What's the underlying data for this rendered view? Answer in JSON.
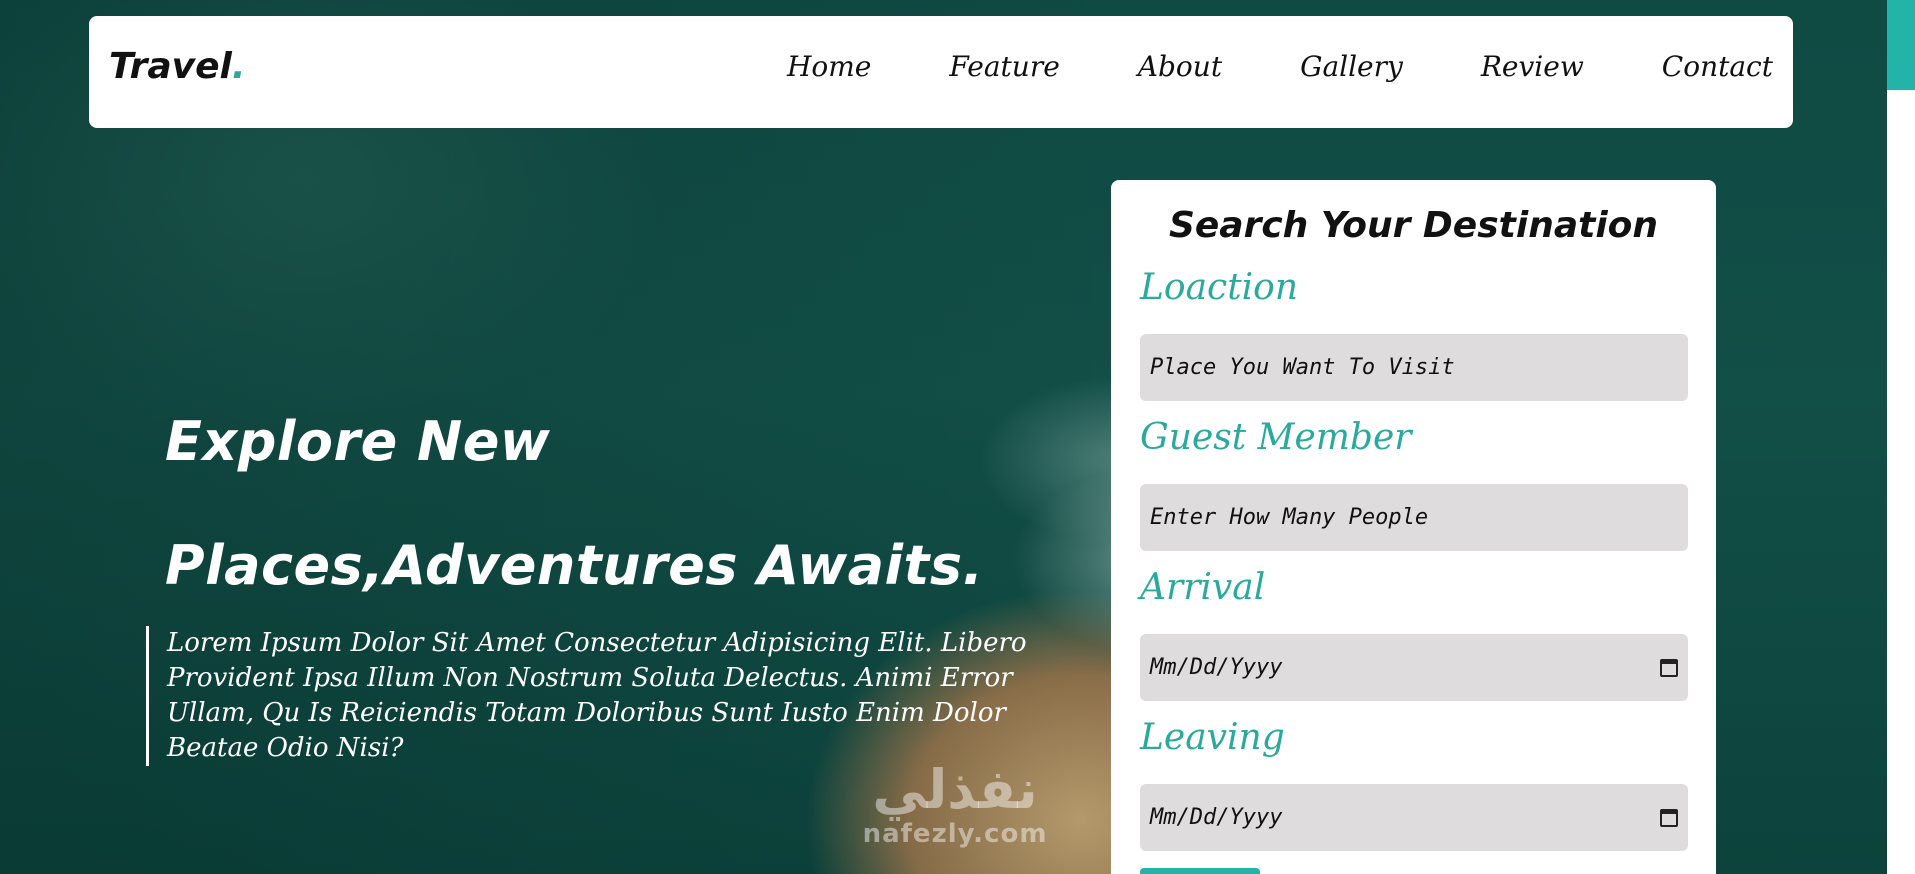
{
  "nav": {
    "logo_text": "Travel",
    "logo_dot": ".",
    "links": [
      "Home",
      "Feature",
      "About",
      "Gallery",
      "Review",
      "Contact"
    ]
  },
  "hero": {
    "title": "Explore New Places,Adventures Awaits.",
    "description": "Lorem Ipsum Dolor Sit Amet Consectetur Adipisicing Elit. Libero Provident Ipsa Illum Non Nostrum Soluta Delectus. Animi Error Ullam, Qu Is Reiciendis Totam Doloribus Sunt Iusto Enim Dolor Beatae Odio Nisi?"
  },
  "watermark": {
    "arabic": "نفذلي",
    "url": "nafezly.com"
  },
  "search": {
    "title": "Search Your Destination",
    "location_label": "Loaction",
    "location_placeholder": "Place You Want To Visit",
    "guest_label": "Guest Member",
    "guest_placeholder": "Enter How Many People",
    "arrival_label": "Arrival",
    "arrival_value": "Mm/Dd/Yyyy",
    "leaving_label": "Leaving",
    "leaving_value": "Mm/Dd/Yyyy"
  },
  "colors": {
    "accent": "#2aa99d",
    "input_bg": "#dedcdd",
    "hero_bg": "#0f4a43"
  }
}
